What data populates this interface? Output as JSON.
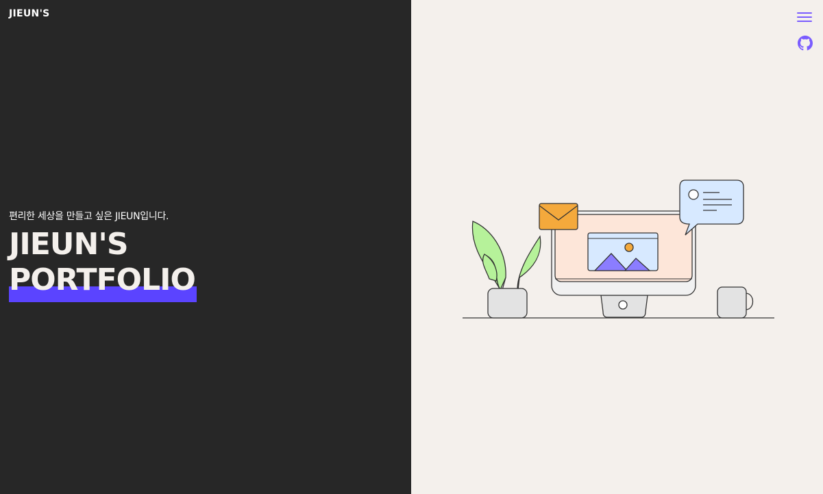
{
  "header": {
    "logo": "JIEUN'S"
  },
  "hero": {
    "subtitle": "편리한 세상을 만들고 싶은 JIEUN입니다.",
    "title_line1": "JIEUN'S",
    "title_line2": "PORTFOLIO"
  },
  "nav": {
    "menu_icon": "hamburger-menu-icon",
    "github_icon": "github-icon"
  },
  "colors": {
    "left_bg": "#272727",
    "right_bg": "#f4f0ec",
    "accent": "#5b44ff",
    "icon": "#7a5cff"
  }
}
